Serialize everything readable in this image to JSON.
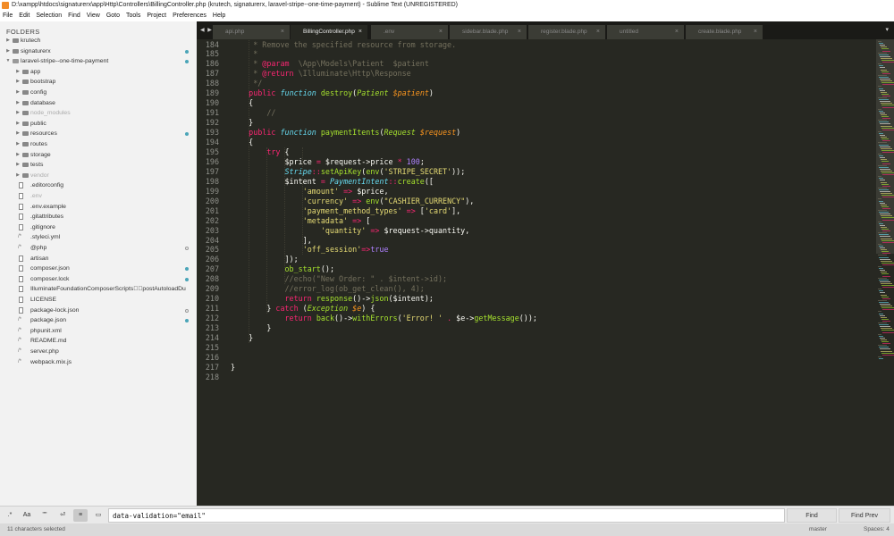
{
  "window": {
    "title": "D:\\xampp\\htdocs\\signaturerx\\app\\Http\\Controllers\\BillingController.php (krutech, signaturerx, laravel-stripe--one-time-payment) - Sublime Text (UNREGISTERED)"
  },
  "menu": [
    "File",
    "Edit",
    "Selection",
    "Find",
    "View",
    "Goto",
    "Tools",
    "Project",
    "Preferences",
    "Help"
  ],
  "sidebar": {
    "title": "FOLDERS",
    "items": [
      {
        "label": "krutech",
        "type": "folder",
        "depth": 0,
        "open": false,
        "dot": ""
      },
      {
        "label": "signaturerx",
        "type": "folder",
        "depth": 0,
        "open": false,
        "dot": "filled"
      },
      {
        "label": "laravel-stripe--one-time-payment",
        "type": "folder",
        "depth": 0,
        "open": true,
        "dot": "filled"
      },
      {
        "label": "app",
        "type": "folder",
        "depth": 1,
        "open": false,
        "dot": ""
      },
      {
        "label": "bootstrap",
        "type": "folder",
        "depth": 1,
        "open": false,
        "dot": ""
      },
      {
        "label": "config",
        "type": "folder",
        "depth": 1,
        "open": false,
        "dot": ""
      },
      {
        "label": "database",
        "type": "folder",
        "depth": 1,
        "open": false,
        "dot": ""
      },
      {
        "label": "node_modules",
        "type": "folder",
        "depth": 1,
        "open": false,
        "dot": "",
        "dim": true
      },
      {
        "label": "public",
        "type": "folder",
        "depth": 1,
        "open": false,
        "dot": ""
      },
      {
        "label": "resources",
        "type": "folder",
        "depth": 1,
        "open": false,
        "dot": "filled"
      },
      {
        "label": "routes",
        "type": "folder",
        "depth": 1,
        "open": false,
        "dot": ""
      },
      {
        "label": "storage",
        "type": "folder",
        "depth": 1,
        "open": false,
        "dot": ""
      },
      {
        "label": "tests",
        "type": "folder",
        "depth": 1,
        "open": false,
        "dot": ""
      },
      {
        "label": "vendor",
        "type": "folder",
        "depth": 1,
        "open": false,
        "dot": "",
        "dim": true
      },
      {
        "label": ".editorconfig",
        "type": "file",
        "depth": 1,
        "dot": ""
      },
      {
        "label": ".env",
        "type": "file",
        "depth": 1,
        "dot": "",
        "dim": true
      },
      {
        "label": ".env.example",
        "type": "file",
        "depth": 1,
        "dot": ""
      },
      {
        "label": ".gitattributes",
        "type": "file",
        "depth": 1,
        "dot": ""
      },
      {
        "label": ".gitignore",
        "type": "file",
        "depth": 1,
        "dot": ""
      },
      {
        "label": ".styleci.yml",
        "type": "code",
        "depth": 1,
        "dot": ""
      },
      {
        "label": "@php",
        "type": "code",
        "depth": 1,
        "dot": "hollow"
      },
      {
        "label": "artisan",
        "type": "file",
        "depth": 1,
        "dot": ""
      },
      {
        "label": "composer.json",
        "type": "file",
        "depth": 1,
        "dot": "filled"
      },
      {
        "label": "composer.lock",
        "type": "file",
        "depth": 1,
        "dot": "filled"
      },
      {
        "label": "IlluminateFoundationComposerScripts\u0000\u0000postAutoloadDu",
        "type": "file",
        "depth": 1,
        "dot": ""
      },
      {
        "label": "LICENSE",
        "type": "file",
        "depth": 1,
        "dot": ""
      },
      {
        "label": "package-lock.json",
        "type": "file",
        "depth": 1,
        "dot": "hollow"
      },
      {
        "label": "package.json",
        "type": "code",
        "depth": 1,
        "dot": "filled"
      },
      {
        "label": "phpunit.xml",
        "type": "code",
        "depth": 1,
        "dot": ""
      },
      {
        "label": "README.md",
        "type": "code",
        "depth": 1,
        "dot": ""
      },
      {
        "label": "server.php",
        "type": "code",
        "depth": 1,
        "dot": ""
      },
      {
        "label": "webpack.mix.js",
        "type": "code",
        "depth": 1,
        "dot": ""
      }
    ]
  },
  "tabs": {
    "nav": "◀ ▶",
    "items": [
      {
        "label": "api.php",
        "active": false
      },
      {
        "label": "BillingController.php",
        "active": true
      },
      {
        "label": ".env",
        "active": false
      },
      {
        "label": "sidebar.blade.php",
        "active": false
      },
      {
        "label": "register.blade.php",
        "active": false
      },
      {
        "label": "untitled",
        "active": false
      },
      {
        "label": "create.blade.php",
        "active": false
      }
    ],
    "close_glyph": "×",
    "dropdown_glyph": "▾"
  },
  "editor": {
    "lines": [
      {
        "n": "184",
        "segs": [
          [
            "c-cm",
            "     * Remove the specified resource from storage."
          ]
        ]
      },
      {
        "n": "185",
        "segs": [
          [
            "c-cm",
            "     *"
          ]
        ]
      },
      {
        "n": "186",
        "segs": [
          [
            "c-cm",
            "     * "
          ],
          [
            "c-tag",
            "@param"
          ],
          [
            "c-cm",
            "  \\App\\Models\\Patient  $patient"
          ]
        ]
      },
      {
        "n": "187",
        "segs": [
          [
            "c-cm",
            "     * "
          ],
          [
            "c-tag",
            "@return"
          ],
          [
            "c-cm",
            " \\Illuminate\\Http\\Response"
          ]
        ]
      },
      {
        "n": "188",
        "segs": [
          [
            "c-cm",
            "     */"
          ]
        ]
      },
      {
        "n": "189",
        "segs": [
          [
            "c-def",
            "    "
          ],
          [
            "c-kw",
            "public"
          ],
          [
            "c-def",
            " "
          ],
          [
            "c-st",
            "function"
          ],
          [
            "c-def",
            " "
          ],
          [
            "c-fn",
            "destroy"
          ],
          [
            "c-def",
            "("
          ],
          [
            "c-cl",
            "Patient"
          ],
          [
            "c-def",
            " "
          ],
          [
            "c-vr",
            "$patient"
          ],
          [
            "c-def",
            ")"
          ]
        ]
      },
      {
        "n": "190",
        "segs": [
          [
            "c-def",
            "    {"
          ]
        ]
      },
      {
        "n": "191",
        "segs": [
          [
            "c-cm",
            "        //"
          ]
        ]
      },
      {
        "n": "192",
        "segs": [
          [
            "c-def",
            "    }"
          ]
        ]
      },
      {
        "n": "193",
        "segs": [
          [
            "c-def",
            "    "
          ],
          [
            "c-kw",
            "public"
          ],
          [
            "c-def",
            " "
          ],
          [
            "c-st",
            "function"
          ],
          [
            "c-def",
            " "
          ],
          [
            "c-fn",
            "paymentItents"
          ],
          [
            "c-def",
            "("
          ],
          [
            "c-cl",
            "Request"
          ],
          [
            "c-def",
            " "
          ],
          [
            "c-vr",
            "$request"
          ],
          [
            "c-def",
            ")"
          ]
        ]
      },
      {
        "n": "194",
        "segs": [
          [
            "c-def",
            "    {"
          ]
        ]
      },
      {
        "n": "195",
        "segs": [
          [
            "c-def",
            "        "
          ],
          [
            "c-kw",
            "try"
          ],
          [
            "c-def",
            " {"
          ]
        ]
      },
      {
        "n": "196",
        "segs": [
          [
            "c-def",
            "            $price "
          ],
          [
            "c-kw",
            "="
          ],
          [
            "c-def",
            " $request->price "
          ],
          [
            "c-kw",
            "*"
          ],
          [
            "c-def",
            " "
          ],
          [
            "c-num",
            "100"
          ],
          [
            "c-def",
            ";"
          ]
        ]
      },
      {
        "n": "197",
        "segs": [
          [
            "c-def",
            "            "
          ],
          [
            "c-st",
            "Stripe"
          ],
          [
            "c-kw",
            "::"
          ],
          [
            "c-fn",
            "setApiKey"
          ],
          [
            "c-def",
            "("
          ],
          [
            "c-fn",
            "env"
          ],
          [
            "c-def",
            "("
          ],
          [
            "c-str",
            "'STRIPE_SECRET'"
          ],
          [
            "c-def",
            "));"
          ]
        ]
      },
      {
        "n": "198",
        "segs": [
          [
            "c-def",
            "            $intent "
          ],
          [
            "c-kw",
            "="
          ],
          [
            "c-def",
            " "
          ],
          [
            "c-st",
            "PaymentIntent"
          ],
          [
            "c-kw",
            "::"
          ],
          [
            "c-fn",
            "create"
          ],
          [
            "c-def",
            "(["
          ]
        ]
      },
      {
        "n": "199",
        "segs": [
          [
            "c-def",
            "                "
          ],
          [
            "c-str",
            "'amount'"
          ],
          [
            "c-def",
            " "
          ],
          [
            "c-kw",
            "=>"
          ],
          [
            "c-def",
            " $price,"
          ]
        ]
      },
      {
        "n": "200",
        "segs": [
          [
            "c-def",
            "                "
          ],
          [
            "c-str",
            "'currency'"
          ],
          [
            "c-def",
            " "
          ],
          [
            "c-kw",
            "=>"
          ],
          [
            "c-def",
            " "
          ],
          [
            "c-fn",
            "env"
          ],
          [
            "c-def",
            "("
          ],
          [
            "c-str",
            "\"CASHIER_CURRENCY\""
          ],
          [
            "c-def",
            "),"
          ]
        ]
      },
      {
        "n": "201",
        "segs": [
          [
            "c-def",
            "                "
          ],
          [
            "c-str",
            "'payment_method_types'"
          ],
          [
            "c-def",
            " "
          ],
          [
            "c-kw",
            "=>"
          ],
          [
            "c-def",
            " ["
          ],
          [
            "c-str",
            "'card'"
          ],
          [
            "c-def",
            "],"
          ]
        ]
      },
      {
        "n": "202",
        "segs": [
          [
            "c-def",
            "                "
          ],
          [
            "c-str",
            "'metadata'"
          ],
          [
            "c-def",
            " "
          ],
          [
            "c-kw",
            "=>"
          ],
          [
            "c-def",
            " ["
          ]
        ]
      },
      {
        "n": "203",
        "segs": [
          [
            "c-def",
            "                    "
          ],
          [
            "c-str",
            "'quantity'"
          ],
          [
            "c-def",
            " "
          ],
          [
            "c-kw",
            "=>"
          ],
          [
            "c-def",
            " $request->quantity,"
          ]
        ]
      },
      {
        "n": "204",
        "segs": [
          [
            "c-def",
            "                ],"
          ]
        ]
      },
      {
        "n": "205",
        "segs": [
          [
            "c-def",
            "                "
          ],
          [
            "c-str",
            "'off_session'"
          ],
          [
            "c-kw",
            "=>"
          ],
          [
            "c-num",
            "true"
          ]
        ]
      },
      {
        "n": "206",
        "segs": [
          [
            "c-def",
            "            ]);"
          ]
        ]
      },
      {
        "n": "207",
        "segs": [
          [
            "c-def",
            "            "
          ],
          [
            "c-fn",
            "ob_start"
          ],
          [
            "c-def",
            "();"
          ]
        ]
      },
      {
        "n": "208",
        "segs": [
          [
            "c-cm",
            "            //echo(\"New Order: \" . $intent->id);"
          ]
        ]
      },
      {
        "n": "209",
        "segs": [
          [
            "c-cm",
            "            //error_log(ob_get_clean(), 4);"
          ]
        ]
      },
      {
        "n": "210",
        "segs": [
          [
            "c-def",
            "            "
          ],
          [
            "c-kw",
            "return"
          ],
          [
            "c-def",
            " "
          ],
          [
            "c-fn",
            "response"
          ],
          [
            "c-def",
            "()->"
          ],
          [
            "c-fn",
            "json"
          ],
          [
            "c-def",
            "($intent);"
          ]
        ]
      },
      {
        "n": "211",
        "segs": [
          [
            "c-def",
            "        } "
          ],
          [
            "c-kw",
            "catch"
          ],
          [
            "c-def",
            " ("
          ],
          [
            "c-cl",
            "Exception"
          ],
          [
            "c-def",
            " "
          ],
          [
            "c-vr",
            "$e"
          ],
          [
            "c-def",
            ") {"
          ]
        ]
      },
      {
        "n": "212",
        "segs": [
          [
            "c-def",
            "            "
          ],
          [
            "c-kw",
            "return"
          ],
          [
            "c-def",
            " "
          ],
          [
            "c-fn",
            "back"
          ],
          [
            "c-def",
            "()->"
          ],
          [
            "c-fn",
            "withErrors"
          ],
          [
            "c-def",
            "("
          ],
          [
            "c-str",
            "'Error! '"
          ],
          [
            "c-def",
            " "
          ],
          [
            "c-kw",
            "."
          ],
          [
            "c-def",
            " $e->"
          ],
          [
            "c-fn",
            "getMessage"
          ],
          [
            "c-def",
            "());"
          ]
        ]
      },
      {
        "n": "213",
        "segs": [
          [
            "c-def",
            "        }"
          ]
        ]
      },
      {
        "n": "214",
        "segs": [
          [
            "c-def",
            "    }"
          ]
        ]
      },
      {
        "n": "215",
        "segs": [
          [
            "c-def",
            ""
          ]
        ]
      },
      {
        "n": "216",
        "segs": [
          [
            "c-def",
            ""
          ]
        ]
      },
      {
        "n": "217",
        "segs": [
          [
            "c-def",
            "}"
          ]
        ]
      },
      {
        "n": "218",
        "segs": [
          [
            "c-def",
            ""
          ]
        ]
      }
    ]
  },
  "find_panel": {
    "regex_label": ".*",
    "case_label": "Aa",
    "whole_word_label": "\"\"",
    "wrap_label": "⏎",
    "in_selection_label": "≡",
    "highlight_label": "▭",
    "input_value": "data-validation=\"email\"",
    "find_label": "Find",
    "find_prev_label": "Find Prev"
  },
  "status": {
    "selection": "11 characters selected",
    "branch": "master",
    "spaces": "Spaces: 4"
  },
  "colors": {
    "editor_bg": "#272822",
    "sidebar_bg": "#f2f2f2",
    "accent_dot": "#4aa5b8"
  }
}
